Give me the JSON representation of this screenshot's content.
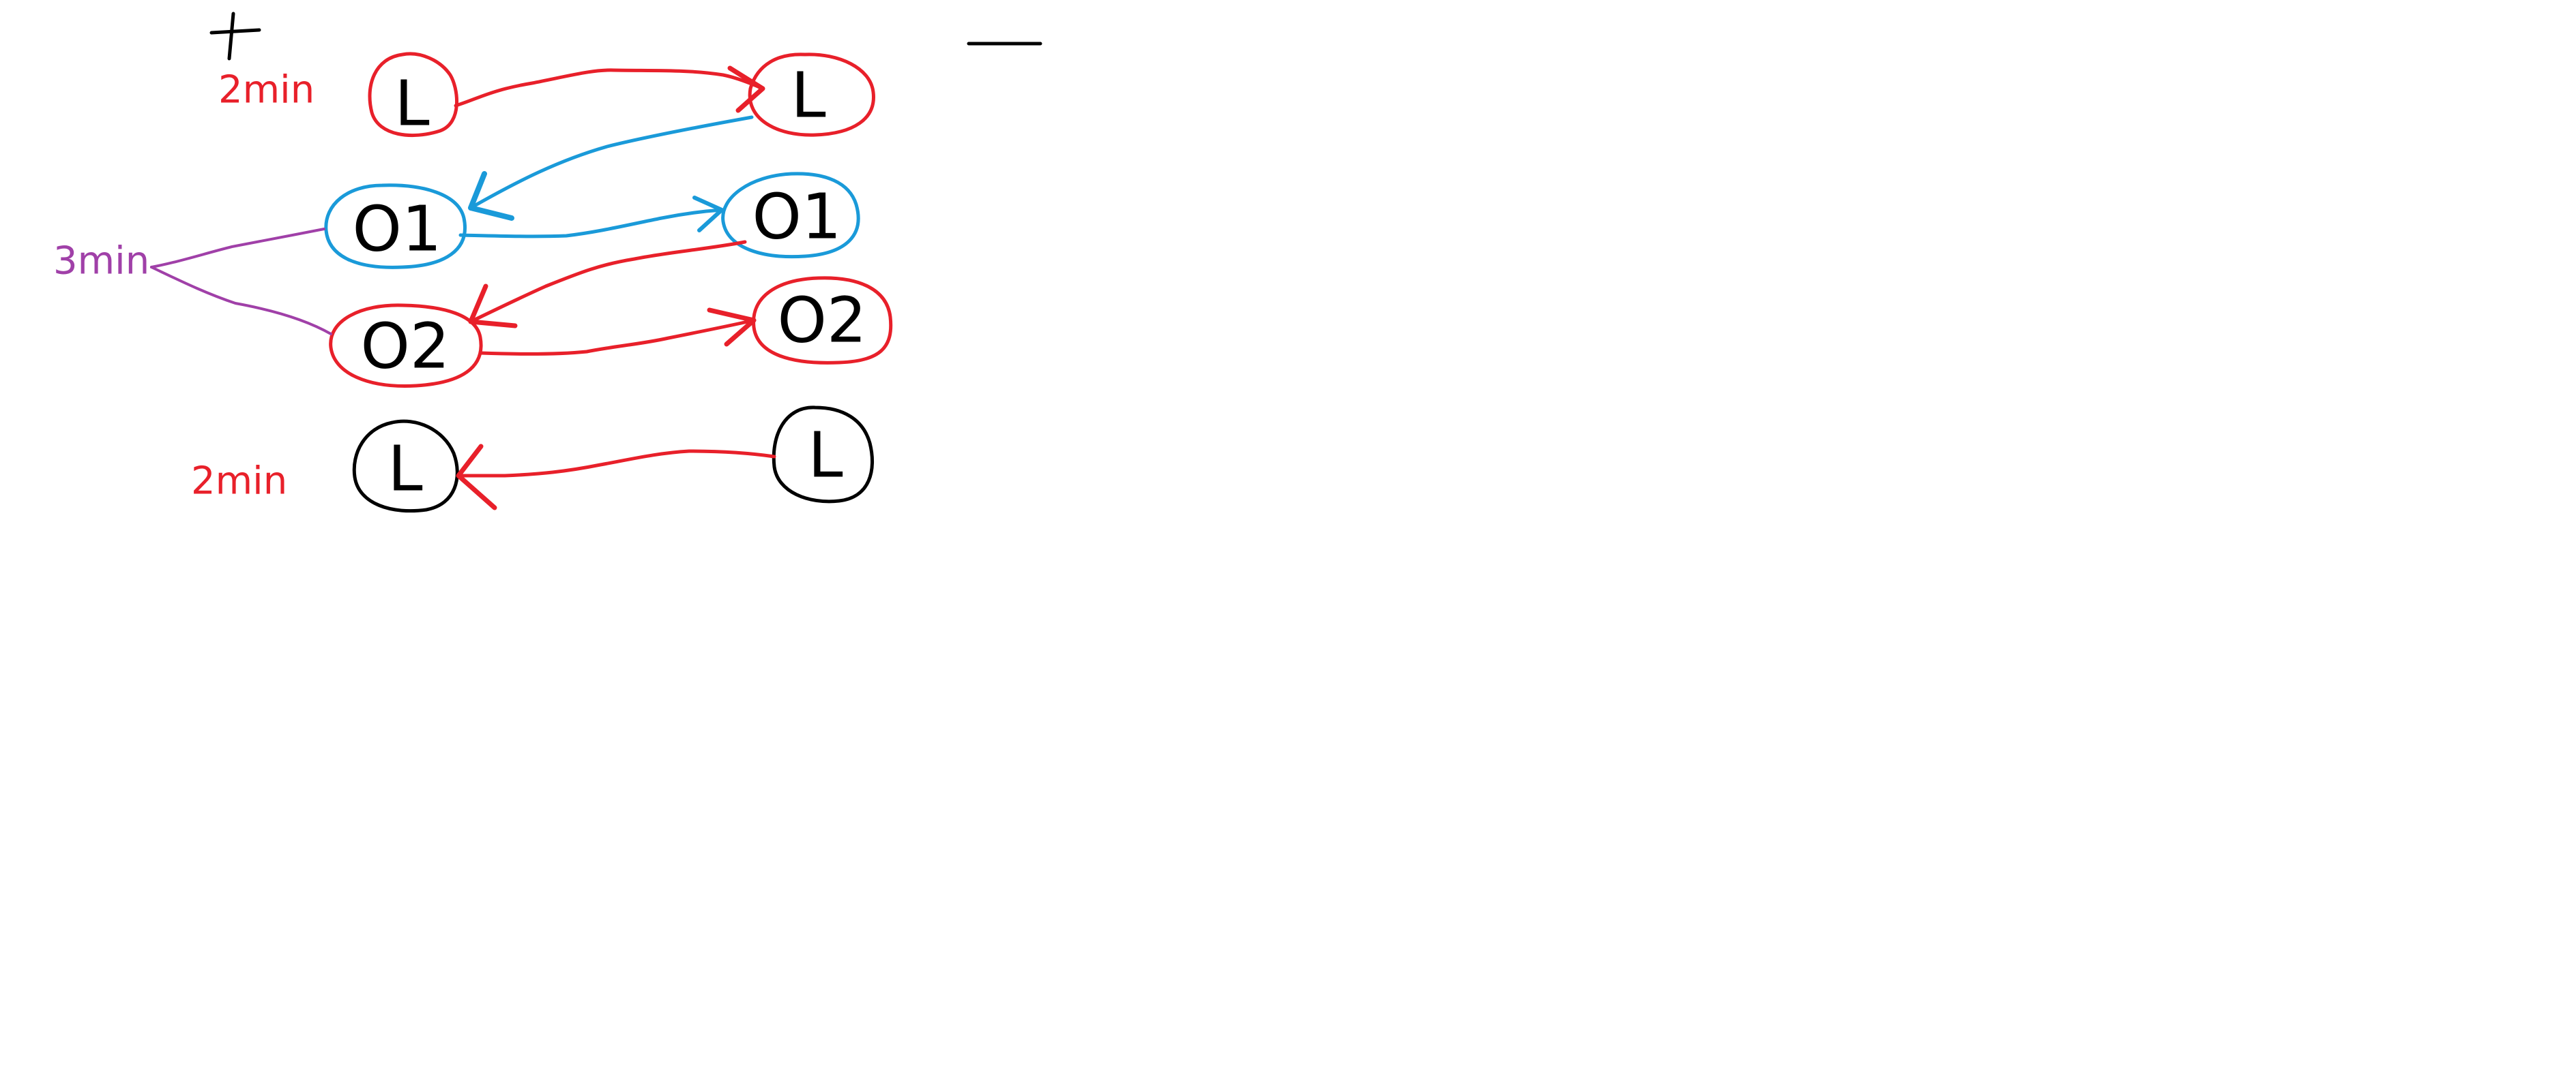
{
  "labels": {
    "time_top": "2min",
    "time_middle": "3min",
    "time_bottom": "2min",
    "plus_sign": "+",
    "minus_sign": "—"
  },
  "nodes": [
    {
      "id": "left-l-top",
      "text": "L",
      "color": "#e8202a"
    },
    {
      "id": "right-l-top",
      "text": "L",
      "color": "#e8202a"
    },
    {
      "id": "left-o1",
      "text": "O1",
      "color": "#1a9ad9"
    },
    {
      "id": "right-o1",
      "text": "O1",
      "color": "#1a9ad9"
    },
    {
      "id": "left-o2",
      "text": "O2",
      "color": "#e8202a"
    },
    {
      "id": "right-o2",
      "text": "O2",
      "color": "#e8202a"
    },
    {
      "id": "left-l-bottom",
      "text": "L",
      "color": "#000000"
    },
    {
      "id": "right-l-bottom",
      "text": "L",
      "color": "#000000"
    }
  ],
  "colors": {
    "red": "#e8202a",
    "blue": "#1a9ad9",
    "purple": "#a040a8",
    "black": "#000000"
  }
}
